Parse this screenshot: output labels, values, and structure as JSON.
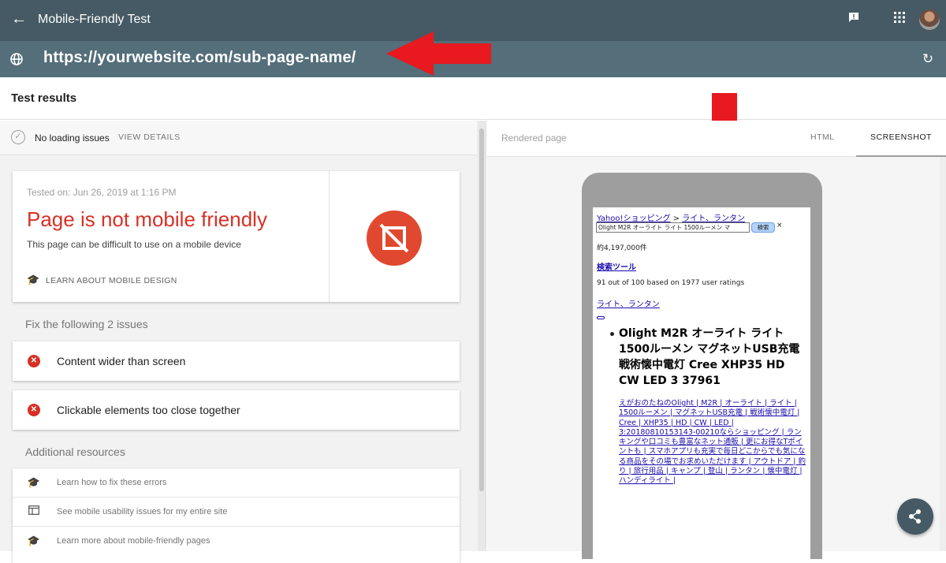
{
  "app": {
    "title": "Mobile-Friendly Test"
  },
  "toolbar": {
    "back_icon": "arrow-left-icon",
    "feedback_icon": "feedback-icon",
    "apps_icon": "apps-grid-icon"
  },
  "url_bar": {
    "url": "https://yourwebsite.com/sub-page-name/",
    "globe_icon": "globe-icon",
    "refresh_icon": "refresh-icon"
  },
  "results": {
    "title": "Test results"
  },
  "status": {
    "text": "No loading issues",
    "view_details": "VIEW DETAILS"
  },
  "main_card": {
    "tested_on": "Tested on: Jun 26, 2019 at 1:16 PM",
    "verdict": "Page is not mobile friendly",
    "subtitle": "This page can be difficult to use on a mobile device",
    "learn_link": "LEARN ABOUT MOBILE DESIGN"
  },
  "issues": {
    "heading": "Fix the following 2 issues",
    "items": [
      {
        "label": "Content wider than screen"
      },
      {
        "label": "Clickable elements too close together"
      }
    ]
  },
  "resources": {
    "heading": "Additional resources",
    "items": [
      {
        "label": "Learn how to fix these errors",
        "icon": "school-icon"
      },
      {
        "label": "See mobile usability issues for my entire site",
        "icon": "web-icon"
      },
      {
        "label": "Learn more about mobile-friendly pages",
        "icon": "school-icon"
      }
    ]
  },
  "rendered": {
    "title": "Rendered page",
    "tabs": [
      {
        "label": "HTML"
      },
      {
        "label": "SCREENSHOT",
        "active": true
      }
    ]
  },
  "screenshot": {
    "breadcrumb_site": "Yahoo!ショッピング",
    "breadcrumb_sep": ">",
    "breadcrumb_cat": "ライト、ランタン",
    "search_value": "Olight M2R オーライト ライト 1500ルーメン マ",
    "search_button": "検索",
    "clear": "×",
    "count": "約4,197,000件",
    "tools_link": "検索ツール",
    "rating": "91 out of 100 based on 1977 user ratings",
    "category_link": "ライト、ランタン",
    "bullet": "•",
    "product_title": "Olight M2R オーライト ライト 1500ルーメン マグネットUSB充電 戦術懐中電灯 Cree XHP35 HD CW LED 3 37961",
    "description": "えがおのたねのOlight | M2R | オーライト | ライト | 1500ルーメン | マグネットUSB充電 | 戦術懐中電灯 | Cree | XHP35 | HD | CW | LED | 3:20180810153143-00210ならショッピング | ランキングや口コミも豊富なネット通販 | 更にお得なTポイントも | スマホアプリも充実で毎日どこからでも気になる商品をその場でお求めいただけます | アウトドア | 釣り | 旅行用品 | キャンプ | 登山 | ランタン | 懐中電灯 | ハンディライト |"
  },
  "colors": {
    "toolbar": "#455a64",
    "url_bar": "#546e7a",
    "error": "#d93025",
    "annotation_arrow": "#e8191f"
  },
  "share_icon": "share-icon"
}
